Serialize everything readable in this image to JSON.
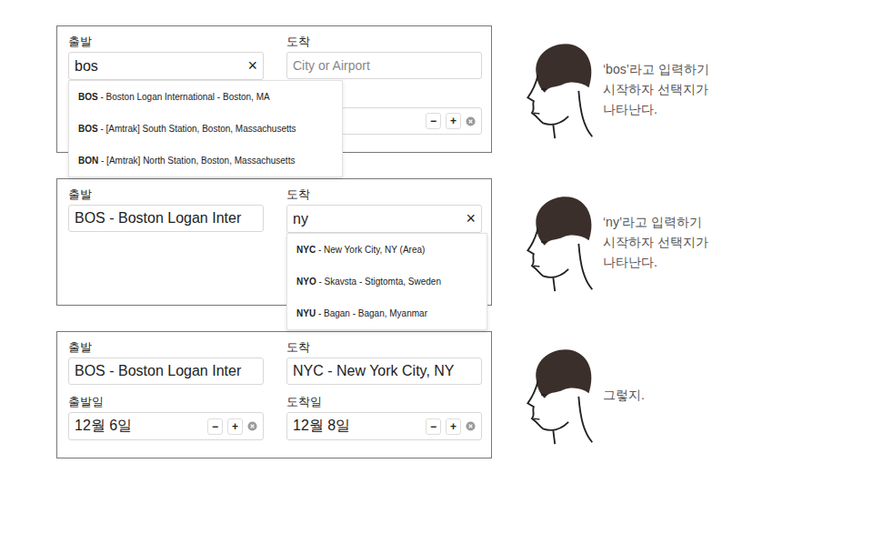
{
  "steps": [
    {
      "form": {
        "rows": [
          {
            "fields": [
              {
                "label": "출발",
                "value": "bos",
                "clear": "×",
                "suggestions": [
                  {
                    "code": "BOS",
                    "rest": " - Boston Logan International - Boston, MA"
                  },
                  {
                    "code": "BOS",
                    "rest": " - [Amtrak] South Station, Boston, Massachusetts"
                  },
                  {
                    "code": "BON",
                    "rest": " - [Amtrak] North Station, Boston, Massachusetts"
                  }
                ]
              },
              {
                "label": "도착",
                "placeholder": "City or Airport"
              }
            ]
          },
          {
            "fields": [
              {},
              {
                "stepper": {
                  "minus": "−",
                  "plus": "+"
                }
              }
            ]
          }
        ]
      },
      "caption": [
        "‘bos’라고 입력하기",
        "시작하자 선택지가",
        "나타난다."
      ]
    },
    {
      "form": {
        "rows": [
          {
            "fields": [
              {
                "label": "출발",
                "value": "BOS - Boston Logan Inter"
              },
              {
                "label": "도착",
                "value": "ny",
                "clear": "×",
                "suggestions": [
                  {
                    "code": "NYC",
                    "rest": " - New York City, NY (Area)"
                  },
                  {
                    "code": "NYO",
                    "rest": " - Skavsta - Stigtomta, Sweden"
                  },
                  {
                    "code": "NYU",
                    "rest": " - Bagan - Bagan, Myanmar"
                  }
                ]
              }
            ]
          }
        ]
      },
      "caption": [
        "‘ny’라고 입력하기",
        "시작하자 선택지가",
        "나타난다."
      ]
    },
    {
      "form": {
        "rows": [
          {
            "fields": [
              {
                "label": "출발",
                "value": "BOS - Boston Logan Inter"
              },
              {
                "label": "도착",
                "value": "NYC - New York City, NY"
              }
            ]
          },
          {
            "fields": [
              {
                "label": "출발일",
                "value": "12월 6일",
                "stepper": {
                  "minus": "−",
                  "plus": "+"
                }
              },
              {
                "label": "도착일",
                "value": "12월 8일",
                "stepper": {
                  "minus": "−",
                  "plus": "+"
                }
              }
            ]
          }
        ]
      },
      "caption": [
        "그렇지."
      ]
    }
  ]
}
